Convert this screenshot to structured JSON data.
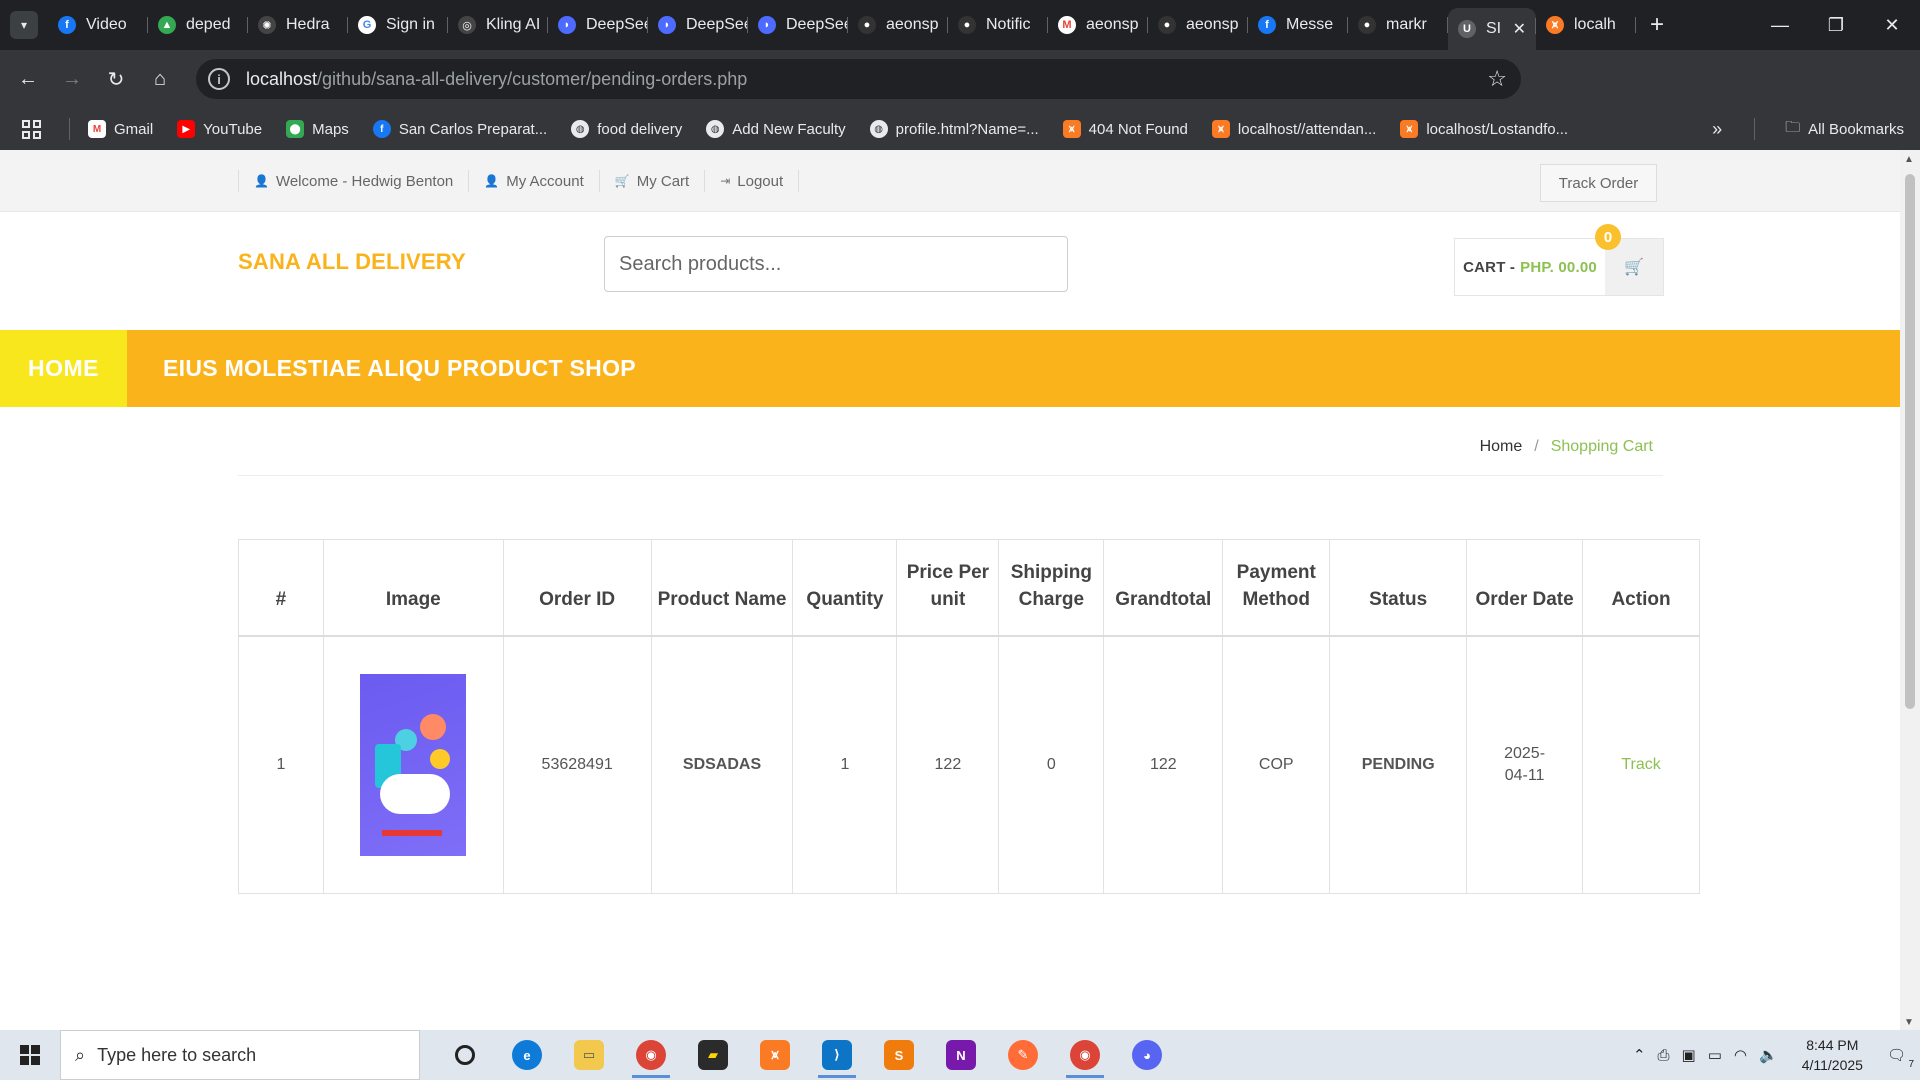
{
  "browser": {
    "tabs": [
      {
        "title": "Video",
        "icon": "facebook-icon",
        "color": "#1877f2"
      },
      {
        "title": "deped",
        "icon": "google-drive-icon",
        "color": "#34a853"
      },
      {
        "title": "Hedra",
        "icon": "hedra-icon",
        "color": "#444"
      },
      {
        "title": "Sign in",
        "icon": "google-icon",
        "color": "#4285f4"
      },
      {
        "title": "Kling AI",
        "icon": "kling-icon",
        "color": "#444"
      },
      {
        "title": "DeepSeek",
        "icon": "deepseek-icon",
        "color": "#4d6bfe"
      },
      {
        "title": "DeepSeek",
        "icon": "deepseek-icon",
        "color": "#4d6bfe"
      },
      {
        "title": "DeepSeek",
        "icon": "deepseek-icon",
        "color": "#4d6bfe"
      },
      {
        "title": "aeonsp",
        "icon": "github-icon",
        "color": "#333"
      },
      {
        "title": "Notific",
        "icon": "github-icon",
        "color": "#333"
      },
      {
        "title": "aeonsp",
        "icon": "gmail-icon",
        "color": "#ea4335"
      },
      {
        "title": "aeonsp",
        "icon": "github-icon",
        "color": "#333"
      },
      {
        "title": "Messe",
        "icon": "facebook-icon",
        "color": "#1877f2"
      },
      {
        "title": "markr",
        "icon": "github-icon",
        "color": "#333"
      }
    ],
    "active_tab": {
      "title": "SI",
      "icon": "site-icon"
    },
    "last_tab": {
      "title": "localh",
      "icon": "xampp-icon"
    },
    "url_host": "localhost",
    "url_path": "/github/sana-all-delivery/customer/pending-orders.php",
    "bookmarks": [
      {
        "label": "Gmail",
        "icon": "gmail-icon",
        "color": "#ea4335"
      },
      {
        "label": "YouTube",
        "icon": "youtube-icon",
        "color": "#ff0000"
      },
      {
        "label": "Maps",
        "icon": "maps-icon",
        "color": "#34a853"
      },
      {
        "label": "San Carlos Preparat...",
        "icon": "facebook-icon",
        "color": "#1877f2"
      },
      {
        "label": "food delivery",
        "icon": "globe-icon",
        "color": "#5f6368"
      },
      {
        "label": "Add New Faculty",
        "icon": "globe-icon",
        "color": "#5f6368"
      },
      {
        "label": "profile.html?Name=...",
        "icon": "globe-icon",
        "color": "#5f6368"
      },
      {
        "label": "404 Not Found",
        "icon": "xampp-icon",
        "color": "#fb7a24"
      },
      {
        "label": "localhost//attendan...",
        "icon": "xampp-icon",
        "color": "#fb7a24"
      },
      {
        "label": "localhost/Lostandfo...",
        "icon": "xampp-icon",
        "color": "#fb7a24"
      }
    ],
    "all_bookmarks": "All Bookmarks"
  },
  "site": {
    "toplinks": [
      {
        "label": "Welcome - Hedwig Benton",
        "icon": "user-icon"
      },
      {
        "label": "My Account",
        "icon": "user-icon"
      },
      {
        "label": "My Cart",
        "icon": "cart-icon"
      },
      {
        "label": "Logout",
        "icon": "logout-icon"
      }
    ],
    "track_order": "Track Order",
    "logo": "SANA ALL DELIVERY",
    "search_placeholder": "Search products...",
    "cart_label": "CART -",
    "cart_price": "PHP. 00.00",
    "cart_count": "0",
    "nav_home": "HOME",
    "nav_shop": "EIUS MOLESTIAE ALIQU PRODUCT SHOP",
    "breadcrumb_home": "Home",
    "breadcrumb_sep": "/",
    "breadcrumb_current": "Shopping Cart",
    "colors": {
      "brand": "#fbb31b",
      "home": "#f8e71c",
      "accent": "#8cc152"
    }
  },
  "orders": {
    "headers": [
      "#",
      "Image",
      "Order ID",
      "Product Name",
      "Quantity",
      "Price Per unit",
      "Shipping Charge",
      "Grandtotal",
      "Payment Method",
      "Status",
      "Order Date",
      "Action"
    ],
    "rows": [
      {
        "num": "1",
        "order_id": "53628491",
        "product": "SDSADAS",
        "qty": "1",
        "price": "122",
        "shipping": "0",
        "total": "122",
        "payment": "COP",
        "status": "PENDING",
        "date": "2025-04-11",
        "action": "Track"
      }
    ]
  },
  "taskbar": {
    "search_placeholder": "Type here to search",
    "time": "8:44 PM",
    "date": "4/11/2025",
    "notification_count": "7"
  }
}
